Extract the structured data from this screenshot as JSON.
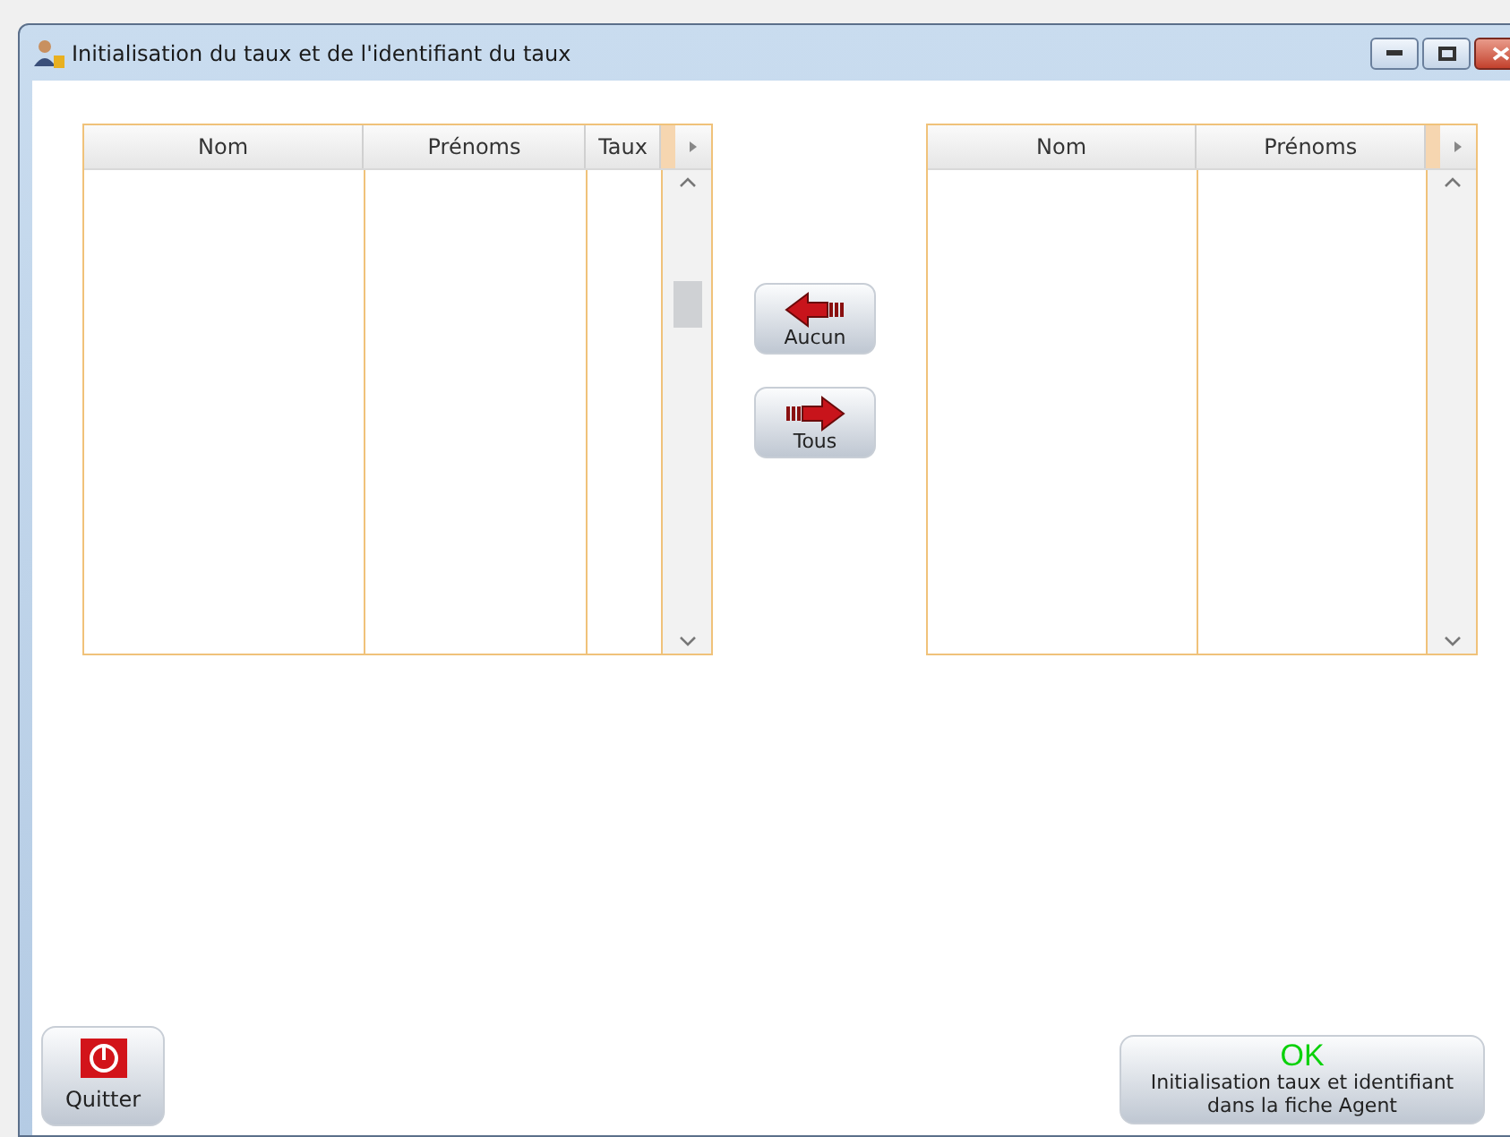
{
  "window": {
    "title": "Initialisation du taux et de l'identifiant du taux"
  },
  "left_table": {
    "columns": [
      "Nom",
      "Prénoms",
      "Taux"
    ]
  },
  "transfer_buttons": [
    {
      "label": "Aucun",
      "kind": "left"
    },
    {
      "label": "Tous",
      "kind": "right"
    }
  ],
  "right_table": {
    "columns": [
      "Nom",
      "Prénoms"
    ]
  },
  "quit_button": {
    "label": "Quitter"
  },
  "ok_button": {
    "badge": "OK",
    "label": "Initialisation taux et identifiant dans la fiche Agent"
  }
}
